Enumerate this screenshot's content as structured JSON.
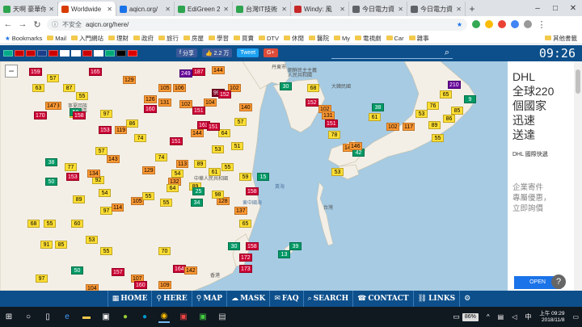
{
  "tabs": [
    {
      "label": "天啊 豪華你",
      "color": "#2ea44f"
    },
    {
      "label": "Worldwide",
      "color": "#d83b01",
      "active": true
    },
    {
      "label": "aqicn.org/",
      "color": "#1a73e8"
    },
    {
      "label": "EdiGreen 2",
      "color": "#2ea44f"
    },
    {
      "label": "台灣IT技術",
      "color": "#2ea44f"
    },
    {
      "label": "Windy: 風",
      "color": "#c62828"
    },
    {
      "label": "今日電力資",
      "color": "#5f6368"
    },
    {
      "label": "今日電力資",
      "color": "#5f6368"
    }
  ],
  "address": {
    "security": "不安全",
    "url": "aqicn.org/here/"
  },
  "bookmarks": {
    "label": "Bookmarks",
    "items": [
      "Mail",
      "入門網站",
      "理財",
      "政府",
      "旅行",
      "房屋",
      "學習",
      "買賣",
      "DTV",
      "休閒",
      "醫院",
      "My",
      "電視劇",
      "Car",
      "雜事"
    ],
    "other": "其他書籤"
  },
  "header": {
    "share_label": "分享",
    "like_label": "2.2 万",
    "tweet_label": "Tweet",
    "gplus_label": "G+",
    "time": "09:26",
    "flag_colors": [
      "#0a8",
      "#c00",
      "#c00",
      "#1a3e8b",
      "#c00",
      "#fff",
      "#fff",
      "#c00",
      "#fff",
      "#0a7",
      "#000",
      "#d00"
    ]
  },
  "map": {
    "zoom_out": "−",
    "labels": [
      {
        "text": "丹東市"
      },
      {
        "text": "朝鮮民主主義"
      },
      {
        "text": "人民共和國"
      },
      {
        "text": "大韓民國"
      },
      {
        "text": "寧夏回族"
      },
      {
        "text": "自治區"
      },
      {
        "text": "中華人民共和國"
      },
      {
        "text": "台灣"
      },
      {
        "text": "東中國海"
      },
      {
        "text": "黃海"
      },
      {
        "text": "香港"
      }
    ],
    "markers": [
      {
        "v": 159
      },
      {
        "v": 57
      },
      {
        "v": 63
      },
      {
        "v": 87
      },
      {
        "v": 148
      },
      {
        "v": 165
      },
      {
        "v": 249
      },
      {
        "v": 187
      },
      {
        "v": 144
      },
      {
        "v": 147
      },
      {
        "v": 55
      },
      {
        "v": 129
      },
      {
        "v": 105
      },
      {
        "v": 126
      },
      {
        "v": 70
      },
      {
        "v": 106
      },
      {
        "v": 999
      },
      {
        "v": 102
      },
      {
        "v": 50
      },
      {
        "v": 170
      },
      {
        "v": 158
      },
      {
        "v": 160
      },
      {
        "v": 151
      },
      {
        "v": 131
      },
      {
        "v": 102
      },
      {
        "v": 104
      },
      {
        "v": 152
      },
      {
        "v": 153
      },
      {
        "v": 119
      },
      {
        "v": 163
      },
      {
        "v": 74
      },
      {
        "v": 151
      },
      {
        "v": 144
      },
      {
        "v": 64
      },
      {
        "v": 140
      },
      {
        "v": 57
      },
      {
        "v": 97
      },
      {
        "v": 86
      },
      {
        "v": 57
      },
      {
        "v": 74
      },
      {
        "v": 151
      },
      {
        "v": 113
      },
      {
        "v": 89
      },
      {
        "v": 53
      },
      {
        "v": 51
      },
      {
        "v": 38
      },
      {
        "v": 77
      },
      {
        "v": 92
      },
      {
        "v": 143
      },
      {
        "v": 89
      },
      {
        "v": 97
      },
      {
        "v": 105
      },
      {
        "v": 54
      },
      {
        "v": 59
      },
      {
        "v": 50
      },
      {
        "v": 153
      },
      {
        "v": 134
      },
      {
        "v": 132
      },
      {
        "v": 54
      },
      {
        "v": 61
      },
      {
        "v": 55
      },
      {
        "v": 15
      },
      {
        "v": 129
      },
      {
        "v": 64
      },
      {
        "v": 89
      },
      {
        "v": 128
      },
      {
        "v": 55
      },
      {
        "v": 25
      },
      {
        "v": 158
      },
      {
        "v": 98
      },
      {
        "v": 114
      },
      {
        "v": 34
      },
      {
        "v": 68
      },
      {
        "v": 55
      },
      {
        "v": 60
      },
      {
        "v": 137
      },
      {
        "v": 65
      },
      {
        "v": 55
      },
      {
        "v": 91
      },
      {
        "v": 85
      },
      {
        "v": 53
      },
      {
        "v": 97
      },
      {
        "v": 50
      },
      {
        "v": 157
      },
      {
        "v": 158
      },
      {
        "v": 30
      },
      {
        "v": 13
      },
      {
        "v": 39
      },
      {
        "v": 70
      },
      {
        "v": 55
      },
      {
        "v": 172
      },
      {
        "v": 164
      },
      {
        "v": 142
      },
      {
        "v": 173
      },
      {
        "v": 104
      },
      {
        "v": 107
      },
      {
        "v": 109
      },
      {
        "v": 160
      },
      {
        "v": 30
      },
      {
        "v": 68
      },
      {
        "v": 152
      },
      {
        "v": 102
      },
      {
        "v": 131
      },
      {
        "v": 151
      },
      {
        "v": 78
      },
      {
        "v": 38
      },
      {
        "v": 61
      },
      {
        "v": 144
      },
      {
        "v": 102
      },
      {
        "v": 117
      },
      {
        "v": 89
      },
      {
        "v": 55
      },
      {
        "v": 42
      },
      {
        "v": 53
      },
      {
        "v": 210
      },
      {
        "v": 65
      },
      {
        "v": 9
      },
      {
        "v": 76
      },
      {
        "v": 85
      },
      {
        "v": 53
      },
      {
        "v": 86
      },
      {
        "v": 146
      }
    ]
  },
  "ad": {
    "line1": "DHL",
    "line2": "全球220",
    "line3": "個國家",
    "line4": "迅速",
    "line5": "送達",
    "sub": "DHL 國際快遞",
    "small1": "企業寄件",
    "small2": "專屬優惠，",
    "small3": "立即詢價",
    "open": "OPEN",
    "help": "?"
  },
  "nav": {
    "home": "HOME",
    "here": "HERE",
    "map": "MAP",
    "mask": "MASK",
    "faq": "FAQ",
    "search": "SEARCH",
    "contact": "CONTACT",
    "links": "LINKS"
  },
  "taskbar": {
    "battery": "86%",
    "ampm": "上午 09:29",
    "date": "2018/11/8"
  }
}
